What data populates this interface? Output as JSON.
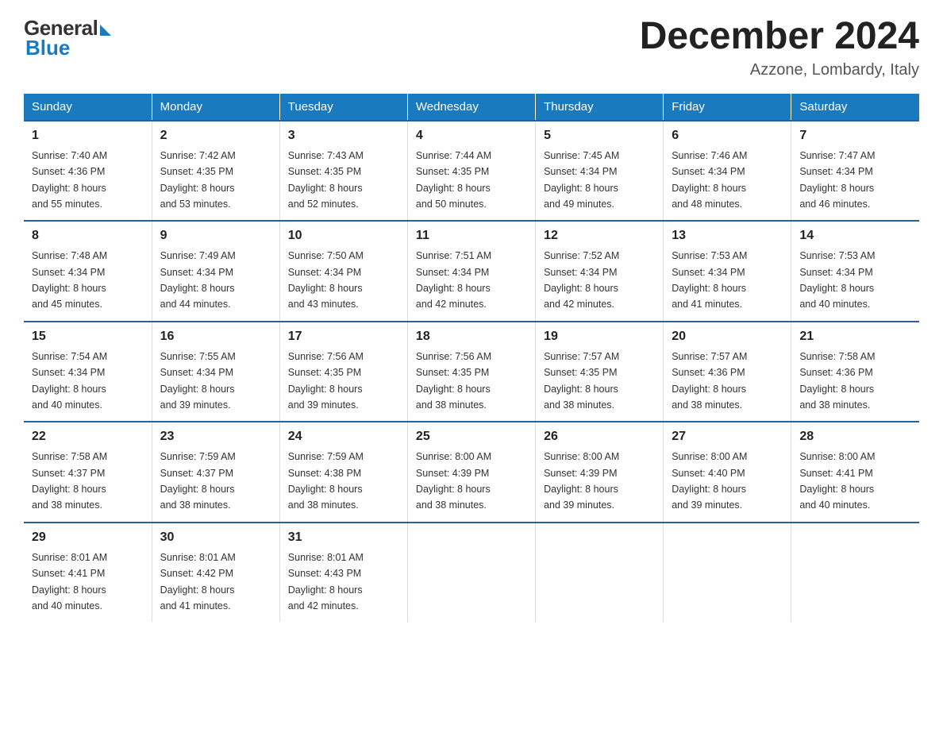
{
  "header": {
    "logo_general": "General",
    "logo_blue": "Blue",
    "month_title": "December 2024",
    "location": "Azzone, Lombardy, Italy"
  },
  "weekdays": [
    "Sunday",
    "Monday",
    "Tuesday",
    "Wednesday",
    "Thursday",
    "Friday",
    "Saturday"
  ],
  "weeks": [
    [
      {
        "day": "1",
        "sunrise": "7:40 AM",
        "sunset": "4:36 PM",
        "daylight": "8 hours and 55 minutes."
      },
      {
        "day": "2",
        "sunrise": "7:42 AM",
        "sunset": "4:35 PM",
        "daylight": "8 hours and 53 minutes."
      },
      {
        "day": "3",
        "sunrise": "7:43 AM",
        "sunset": "4:35 PM",
        "daylight": "8 hours and 52 minutes."
      },
      {
        "day": "4",
        "sunrise": "7:44 AM",
        "sunset": "4:35 PM",
        "daylight": "8 hours and 50 minutes."
      },
      {
        "day": "5",
        "sunrise": "7:45 AM",
        "sunset": "4:34 PM",
        "daylight": "8 hours and 49 minutes."
      },
      {
        "day": "6",
        "sunrise": "7:46 AM",
        "sunset": "4:34 PM",
        "daylight": "8 hours and 48 minutes."
      },
      {
        "day": "7",
        "sunrise": "7:47 AM",
        "sunset": "4:34 PM",
        "daylight": "8 hours and 46 minutes."
      }
    ],
    [
      {
        "day": "8",
        "sunrise": "7:48 AM",
        "sunset": "4:34 PM",
        "daylight": "8 hours and 45 minutes."
      },
      {
        "day": "9",
        "sunrise": "7:49 AM",
        "sunset": "4:34 PM",
        "daylight": "8 hours and 44 minutes."
      },
      {
        "day": "10",
        "sunrise": "7:50 AM",
        "sunset": "4:34 PM",
        "daylight": "8 hours and 43 minutes."
      },
      {
        "day": "11",
        "sunrise": "7:51 AM",
        "sunset": "4:34 PM",
        "daylight": "8 hours and 42 minutes."
      },
      {
        "day": "12",
        "sunrise": "7:52 AM",
        "sunset": "4:34 PM",
        "daylight": "8 hours and 42 minutes."
      },
      {
        "day": "13",
        "sunrise": "7:53 AM",
        "sunset": "4:34 PM",
        "daylight": "8 hours and 41 minutes."
      },
      {
        "day": "14",
        "sunrise": "7:53 AM",
        "sunset": "4:34 PM",
        "daylight": "8 hours and 40 minutes."
      }
    ],
    [
      {
        "day": "15",
        "sunrise": "7:54 AM",
        "sunset": "4:34 PM",
        "daylight": "8 hours and 40 minutes."
      },
      {
        "day": "16",
        "sunrise": "7:55 AM",
        "sunset": "4:34 PM",
        "daylight": "8 hours and 39 minutes."
      },
      {
        "day": "17",
        "sunrise": "7:56 AM",
        "sunset": "4:35 PM",
        "daylight": "8 hours and 39 minutes."
      },
      {
        "day": "18",
        "sunrise": "7:56 AM",
        "sunset": "4:35 PM",
        "daylight": "8 hours and 38 minutes."
      },
      {
        "day": "19",
        "sunrise": "7:57 AM",
        "sunset": "4:35 PM",
        "daylight": "8 hours and 38 minutes."
      },
      {
        "day": "20",
        "sunrise": "7:57 AM",
        "sunset": "4:36 PM",
        "daylight": "8 hours and 38 minutes."
      },
      {
        "day": "21",
        "sunrise": "7:58 AM",
        "sunset": "4:36 PM",
        "daylight": "8 hours and 38 minutes."
      }
    ],
    [
      {
        "day": "22",
        "sunrise": "7:58 AM",
        "sunset": "4:37 PM",
        "daylight": "8 hours and 38 minutes."
      },
      {
        "day": "23",
        "sunrise": "7:59 AM",
        "sunset": "4:37 PM",
        "daylight": "8 hours and 38 minutes."
      },
      {
        "day": "24",
        "sunrise": "7:59 AM",
        "sunset": "4:38 PM",
        "daylight": "8 hours and 38 minutes."
      },
      {
        "day": "25",
        "sunrise": "8:00 AM",
        "sunset": "4:39 PM",
        "daylight": "8 hours and 38 minutes."
      },
      {
        "day": "26",
        "sunrise": "8:00 AM",
        "sunset": "4:39 PM",
        "daylight": "8 hours and 39 minutes."
      },
      {
        "day": "27",
        "sunrise": "8:00 AM",
        "sunset": "4:40 PM",
        "daylight": "8 hours and 39 minutes."
      },
      {
        "day": "28",
        "sunrise": "8:00 AM",
        "sunset": "4:41 PM",
        "daylight": "8 hours and 40 minutes."
      }
    ],
    [
      {
        "day": "29",
        "sunrise": "8:01 AM",
        "sunset": "4:41 PM",
        "daylight": "8 hours and 40 minutes."
      },
      {
        "day": "30",
        "sunrise": "8:01 AM",
        "sunset": "4:42 PM",
        "daylight": "8 hours and 41 minutes."
      },
      {
        "day": "31",
        "sunrise": "8:01 AM",
        "sunset": "4:43 PM",
        "daylight": "8 hours and 42 minutes."
      },
      null,
      null,
      null,
      null
    ]
  ],
  "labels": {
    "sunrise": "Sunrise:",
    "sunset": "Sunset:",
    "daylight": "Daylight:"
  }
}
